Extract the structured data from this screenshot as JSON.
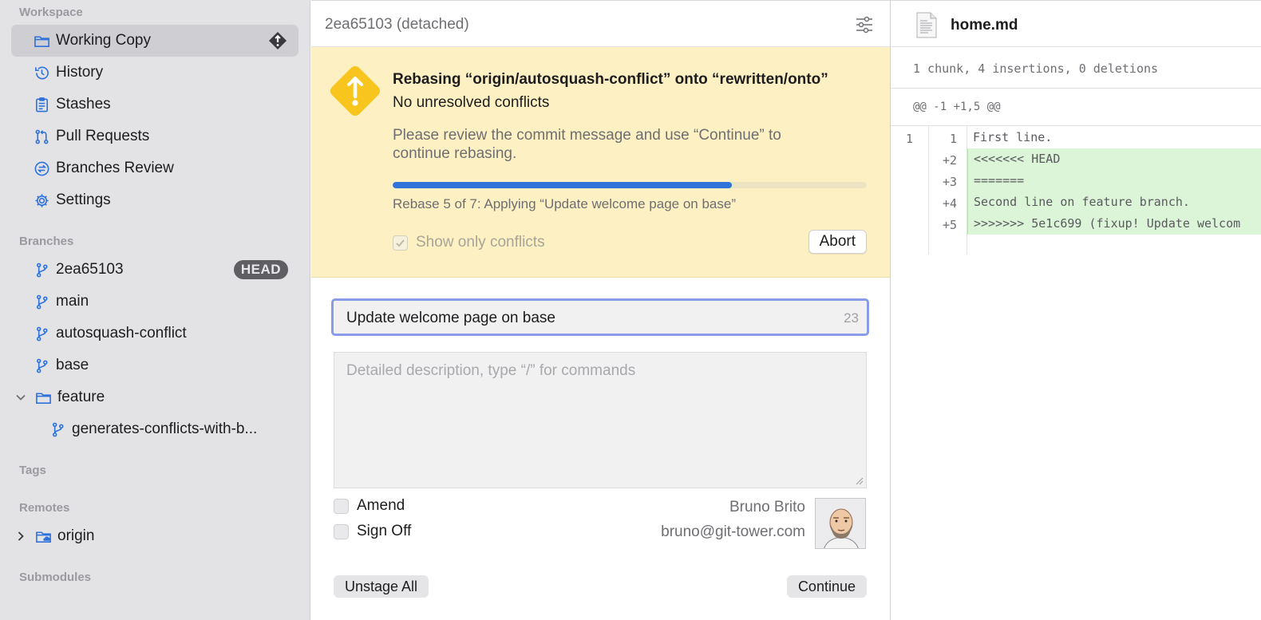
{
  "sidebar": {
    "workspace_title": "Workspace",
    "workspace_items": [
      {
        "label": "Working Copy"
      },
      {
        "label": "History"
      },
      {
        "label": "Stashes"
      },
      {
        "label": "Pull Requests"
      },
      {
        "label": "Branches Review"
      },
      {
        "label": "Settings"
      }
    ],
    "branches_title": "Branches",
    "branches": [
      {
        "label": "2ea65103",
        "badge": "HEAD"
      },
      {
        "label": "main"
      },
      {
        "label": "autosquash-conflict"
      },
      {
        "label": "base"
      }
    ],
    "folder": {
      "label": "feature",
      "children": [
        {
          "label": "generates-conflicts-with-b..."
        }
      ]
    },
    "tags_title": "Tags",
    "remotes_title": "Remotes",
    "remotes": [
      {
        "label": "origin"
      }
    ],
    "submodules_title": "Submodules"
  },
  "middle": {
    "header_title": "2ea65103 (detached)",
    "rebase": {
      "title": "Rebasing “origin/autosquash-conflict” onto “rewritten/onto”",
      "subtitle": "No unresolved conflicts",
      "description": "Please review the commit message and use “Continue” to continue rebasing.",
      "progress_fraction": 0.715,
      "step_text": "Rebase 5 of 7: Applying “Update welcome page on base”",
      "show_conflicts_label": "Show only conflicts",
      "abort_label": "Abort"
    },
    "commit": {
      "summary_value": "Update welcome page on base",
      "summary_count": "23",
      "description_placeholder": "Detailed description, type “/” for commands",
      "amend_label": "Amend",
      "signoff_label": "Sign Off",
      "author_name": "Bruno Brito",
      "author_email": "bruno@git-tower.com",
      "unstage_label": "Unstage All",
      "continue_label": "Continue"
    }
  },
  "diff": {
    "file_name": "home.md",
    "stats": "1 chunk, 4 insertions, 0 deletions",
    "hunk_header": "@@ -1 +1,5 @@",
    "lines": [
      {
        "old": "1",
        "new": "1",
        "text": "First line.",
        "type": "context"
      },
      {
        "old": "",
        "new": "+2",
        "text": "<<<<<<< HEAD",
        "type": "added"
      },
      {
        "old": "",
        "new": "+3",
        "text": "=======",
        "type": "added"
      },
      {
        "old": "",
        "new": "+4",
        "text": "Second line on feature branch.",
        "type": "added"
      },
      {
        "old": "",
        "new": "+5",
        "text": ">>>>>>> 5e1c699 (fixup! Update welcom",
        "type": "added"
      }
    ]
  },
  "colors": {
    "accent": "#2f72dc",
    "rebase_banner": "#fdf0c2",
    "warning": "#f5c518",
    "added_line": "#dcf4d7",
    "focus_ring": "#8a9be7"
  }
}
